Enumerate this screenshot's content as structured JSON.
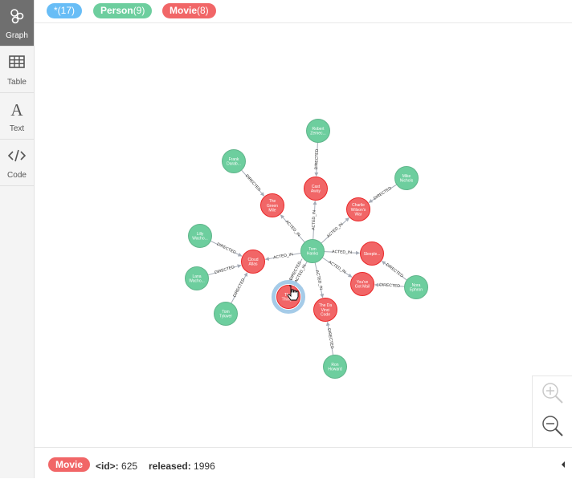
{
  "sidebar": {
    "items": [
      {
        "label": "Graph",
        "icon": "graph-icon"
      },
      {
        "label": "Table",
        "icon": "table-icon"
      },
      {
        "label": "Text",
        "icon": "text-icon"
      },
      {
        "label": "Code",
        "icon": "code-icon"
      }
    ]
  },
  "legend": {
    "all": {
      "name": "*",
      "count": "(17)",
      "color": "#68bdf6"
    },
    "person": {
      "name": "Person",
      "count": "(9)",
      "color": "#6dce9e"
    },
    "movie": {
      "name": "Movie",
      "count": "(8)",
      "color": "#f16667"
    }
  },
  "graph": {
    "colors": {
      "person": "#6dce9e",
      "movie": "#f16667",
      "person_border": "#60b58b",
      "movie_border": "#eb2728",
      "selected_ring": "#a5cbe8"
    },
    "nodes": [
      {
        "id": "hanks",
        "type": "person",
        "lines": [
          "Tom",
          "Hanks"
        ]
      },
      {
        "id": "zemeckis",
        "type": "person",
        "lines": [
          "Robert",
          "Zemec..."
        ]
      },
      {
        "id": "darabont",
        "type": "person",
        "lines": [
          "Frank",
          "Darab..."
        ]
      },
      {
        "id": "nichols",
        "type": "person",
        "lines": [
          "Mike",
          "Nichols"
        ]
      },
      {
        "id": "lilly",
        "type": "person",
        "lines": [
          "Lilly",
          "Wacho..."
        ]
      },
      {
        "id": "lana",
        "type": "person",
        "lines": [
          "Lana",
          "Wacho..."
        ]
      },
      {
        "id": "tykwer",
        "type": "person",
        "lines": [
          "Tom",
          "Tykwer"
        ]
      },
      {
        "id": "ephron",
        "type": "person",
        "lines": [
          "Nora",
          "Ephron"
        ]
      },
      {
        "id": "howard",
        "type": "person",
        "lines": [
          "Ron",
          "Howard"
        ]
      },
      {
        "id": "castaway",
        "type": "movie",
        "lines": [
          "Cast",
          "Away"
        ]
      },
      {
        "id": "greenmile",
        "type": "movie",
        "lines": [
          "The",
          "Green",
          "Mile"
        ]
      },
      {
        "id": "charlie",
        "type": "movie",
        "lines": [
          "Charlie",
          "Wilson's",
          "War"
        ]
      },
      {
        "id": "sleepless",
        "type": "movie",
        "lines": [
          "Sleeple..."
        ]
      },
      {
        "id": "cloudatlas",
        "type": "movie",
        "lines": [
          "Cloud",
          "Atlas"
        ]
      },
      {
        "id": "youvegot",
        "type": "movie",
        "lines": [
          "You've",
          "Got Mail"
        ]
      },
      {
        "id": "thatthing",
        "type": "movie",
        "lines": [
          "That",
          "Thing..."
        ],
        "selected": true
      },
      {
        "id": "davinci",
        "type": "movie",
        "lines": [
          "The Da",
          "Vinci",
          "Code"
        ]
      }
    ],
    "edges": [
      {
        "from": "hanks",
        "to": "castaway",
        "label": "ACTED_IN"
      },
      {
        "from": "hanks",
        "to": "greenmile",
        "label": "ACTED_IN"
      },
      {
        "from": "hanks",
        "to": "charlie",
        "label": "ACTED_IN"
      },
      {
        "from": "hanks",
        "to": "sleepless",
        "label": "ACTED_IN"
      },
      {
        "from": "hanks",
        "to": "cloudatlas",
        "label": "ACTED_IN"
      },
      {
        "from": "hanks",
        "to": "youvegot",
        "label": "ACTED_IN"
      },
      {
        "from": "hanks",
        "to": "thatthing",
        "label": "ACTED_IN"
      },
      {
        "from": "hanks",
        "to": "thatthing",
        "label": "DIRECTED"
      },
      {
        "from": "hanks",
        "to": "davinci",
        "label": "ACTED_IN"
      },
      {
        "from": "zemeckis",
        "to": "castaway",
        "label": "DIRECTED"
      },
      {
        "from": "darabont",
        "to": "greenmile",
        "label": "DIRECTED"
      },
      {
        "from": "nichols",
        "to": "charlie",
        "label": "DIRECTED"
      },
      {
        "from": "lilly",
        "to": "cloudatlas",
        "label": "DIRECTED"
      },
      {
        "from": "lana",
        "to": "cloudatlas",
        "label": "DIRECTED"
      },
      {
        "from": "tykwer",
        "to": "cloudatlas",
        "label": "DIRECTED"
      },
      {
        "from": "ephron",
        "to": "sleepless",
        "label": "DIRECTED"
      },
      {
        "from": "ephron",
        "to": "youvegot",
        "label": "DIRECTED"
      },
      {
        "from": "howard",
        "to": "davinci",
        "label": "DIRECTED"
      }
    ]
  },
  "zoom": {
    "in_icon": "zoom-in-icon",
    "out_icon": "zoom-out-icon"
  },
  "footer": {
    "label": "Movie",
    "id_key": "<id>:",
    "id_value": "625",
    "released_key": "released:",
    "released_value": "1996",
    "collapse_icon": "caret-left-icon"
  }
}
